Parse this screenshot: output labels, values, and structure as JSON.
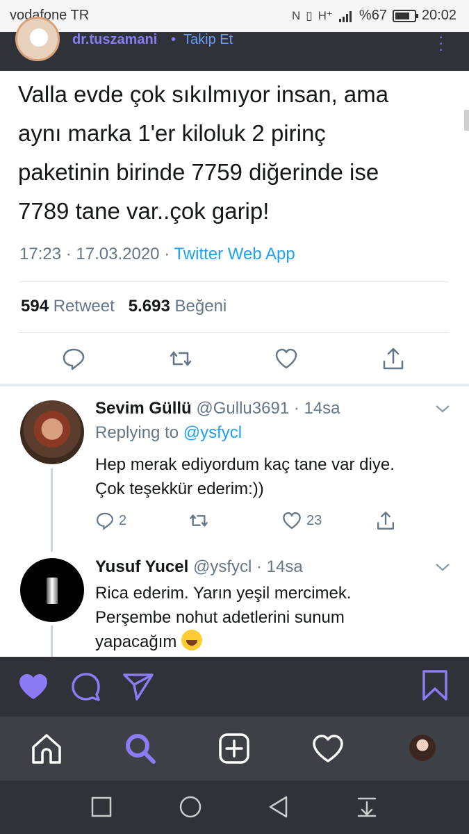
{
  "status_bar": {
    "carrier": "vodafone TR",
    "battery": "%67",
    "time": "20:02",
    "icons": [
      "nfc-icon",
      "vibrate-icon",
      "network-icon",
      "signal-icon",
      "battery-icon"
    ]
  },
  "instagram_header": {
    "username": "dr.tuszamani",
    "separator": "•",
    "follow_label": "Takip Et",
    "more_icon": "more-vertical-icon"
  },
  "tweet": {
    "text_lines": [
      "Valla evde çok sıkılmıyor insan, ama",
      "aynı marka 1'er kiloluk 2 pirinç",
      "paketinin birinde 7759 diğerinde ise",
      "7789 tane var..çok garip!"
    ],
    "time": "17:23",
    "date": "17.03.2020",
    "meta_sep": "·",
    "app": "Twitter Web App",
    "retweet_count": "594",
    "retweet_label": "Retweet",
    "like_count": "5.693",
    "like_label": "Beğeni",
    "action_icons": [
      "reply-icon",
      "retweet-icon",
      "like-icon",
      "share-icon"
    ]
  },
  "replies": [
    {
      "name": "Sevim Güllü",
      "handle": "@Gullu3691",
      "time": "· 14sa",
      "replying_to_label": "Replying to",
      "replying_to_handle": "@ysfycl",
      "text_lines": [
        "Hep merak ediyordum kaç tane var diye.",
        "Çok teşekkür ederim:))"
      ],
      "reply_count": "2",
      "retweet_count": "",
      "like_count": "23"
    },
    {
      "name": "Yusuf Yucel",
      "handle": "@ysfycl",
      "time": "· 14sa",
      "text_lines": [
        "Rica ederim. Yarın yeşil mercimek.",
        "Perşembe nohut adetlerini sunum",
        "yapacağım"
      ],
      "emoji_icon": "rolling-laughing-emoji-icon"
    }
  ],
  "instagram_actions": {
    "icons": [
      "like-filled-icon",
      "comment-icon",
      "send-icon",
      "bookmark-icon"
    ],
    "accent": "#8b7cf5"
  },
  "bottom_nav": {
    "icons": [
      "home-icon",
      "search-icon",
      "add-post-icon",
      "activity-heart-icon",
      "profile-avatar"
    ]
  },
  "system_nav": {
    "icons": [
      "recents-square-icon",
      "home-circle-icon",
      "back-triangle-icon",
      "notification-pull-icon"
    ]
  },
  "colors": {
    "twitter_blue": "#1da1f2",
    "secondary_text": "#657786",
    "instagram_bar": "#2f3339",
    "instagram_nav": "#3d4147"
  }
}
